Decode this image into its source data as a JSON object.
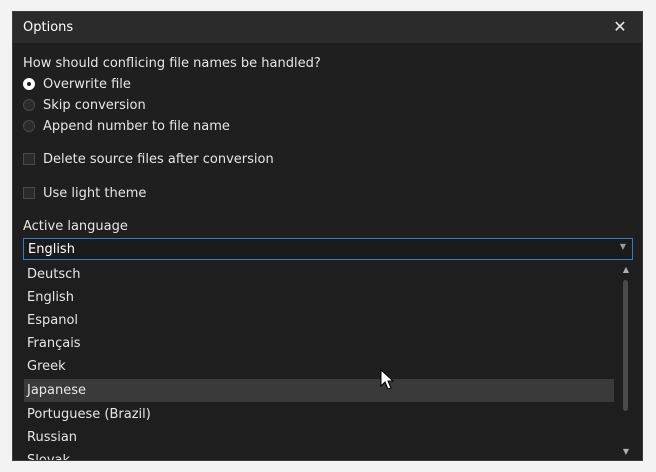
{
  "window": {
    "title": "Options",
    "close_icon": "close-icon"
  },
  "conflict": {
    "question": "How should conflicing file names be handled?",
    "options": [
      {
        "label": "Overwrite file",
        "checked": true
      },
      {
        "label": "Skip conversion",
        "checked": false
      },
      {
        "label": "Append number to file name",
        "checked": false
      }
    ]
  },
  "checkboxes": {
    "delete_source": {
      "label": "Delete source files after conversion",
      "checked": false
    },
    "light_theme": {
      "label": "Use light theme",
      "checked": false
    }
  },
  "language": {
    "label": "Active language",
    "selected": "English",
    "options": [
      "Deutsch",
      "English",
      "Espanol",
      "Français",
      "Greek",
      "Japanese",
      "Portuguese (Brazil)",
      "Russian",
      "Slovak"
    ],
    "hovered": "Japanese"
  },
  "colors": {
    "background": "#1f1f1f",
    "titlebar": "#2b2b2b",
    "accent": "#2f7fd0",
    "hover": "#3a3a3a"
  }
}
